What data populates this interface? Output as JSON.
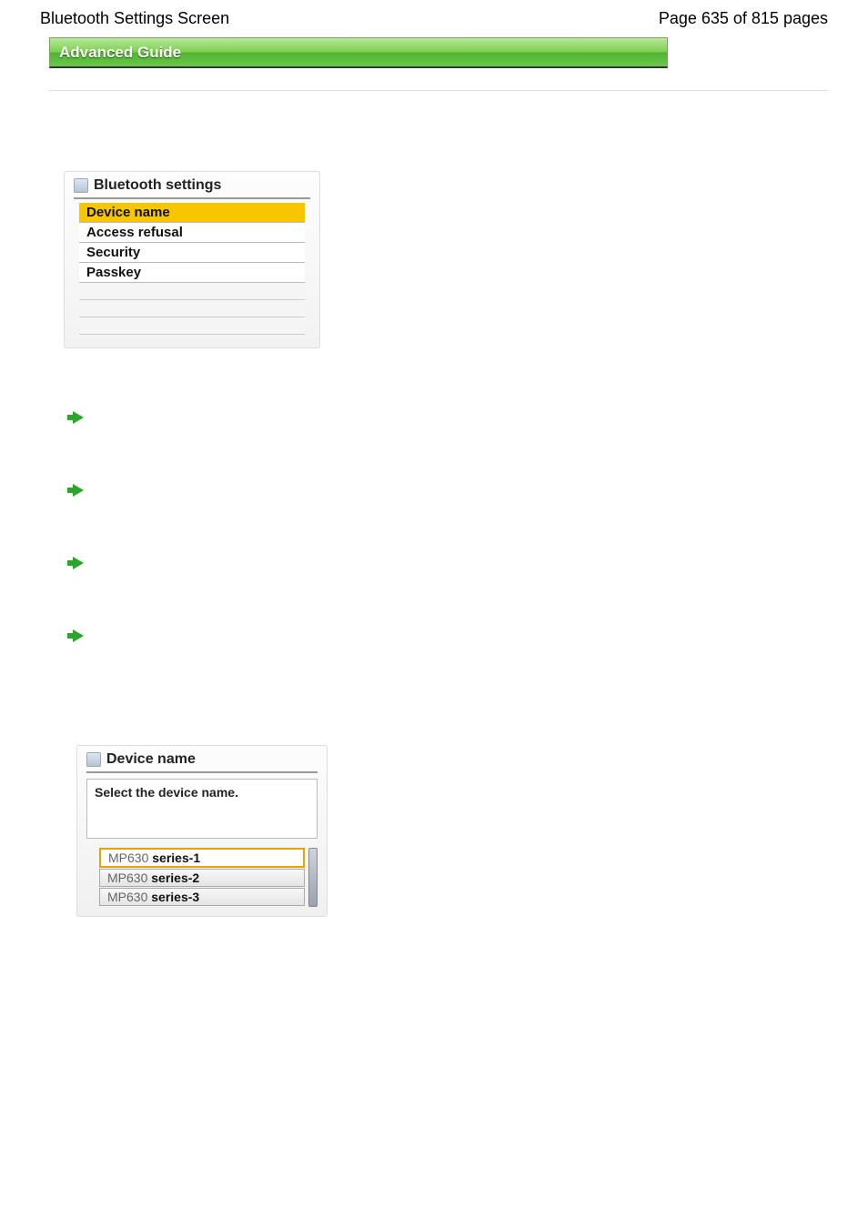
{
  "header": {
    "title": "Bluetooth Settings Screen",
    "page_counter": "Page 635 of 815 pages"
  },
  "banner": {
    "label": "Advanced Guide"
  },
  "bt_panel": {
    "title": "Bluetooth settings",
    "items": [
      {
        "label": "Device name",
        "selected": true
      },
      {
        "label": "Access refusal",
        "selected": false
      },
      {
        "label": "Security",
        "selected": false
      },
      {
        "label": "Passkey",
        "selected": false
      }
    ]
  },
  "device_panel": {
    "title": "Device name",
    "instruction": "Select the device name.",
    "options": [
      {
        "prefix": "MP630 ",
        "suffix": "series-1",
        "selected": true
      },
      {
        "prefix": "MP630 ",
        "suffix": "series-2",
        "selected": false
      },
      {
        "prefix": "MP630 ",
        "suffix": "series-3",
        "selected": false
      }
    ]
  }
}
